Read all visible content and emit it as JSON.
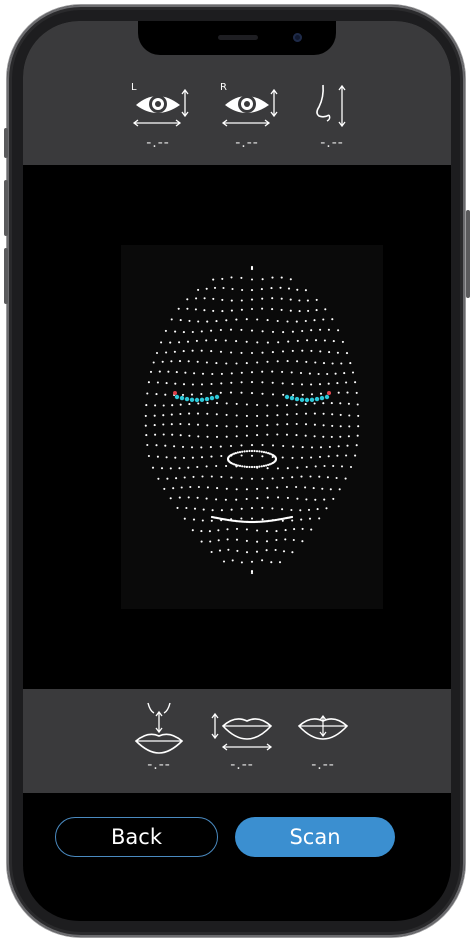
{
  "top_metrics": [
    {
      "id": "left-eye",
      "label": "L",
      "value": "-.--"
    },
    {
      "id": "right-eye",
      "label": "R",
      "value": "-.--"
    },
    {
      "id": "nose",
      "value": "-.--"
    }
  ],
  "bottom_metrics": [
    {
      "id": "philtrum",
      "value": "-.--"
    },
    {
      "id": "lip-width",
      "value": "-.--"
    },
    {
      "id": "lip-height",
      "value": "-.--"
    }
  ],
  "buttons": {
    "back_label": "Back",
    "scan_label": "Scan"
  },
  "icons": {
    "left_eye": "eye-measure-icon",
    "right_eye": "eye-measure-icon",
    "nose": "nose-profile-icon",
    "philtrum": "philtrum-icon",
    "lip_width": "lip-width-icon",
    "lip_height": "lip-center-icon"
  },
  "colors": {
    "panel": "#3a3a3c",
    "scan_button": "#3b8fd0",
    "back_border": "#4a8ac0",
    "eye_landmark": "#2ec8d8",
    "eye_corner": "#e0404a",
    "mesh_dot": "#ffffff"
  }
}
